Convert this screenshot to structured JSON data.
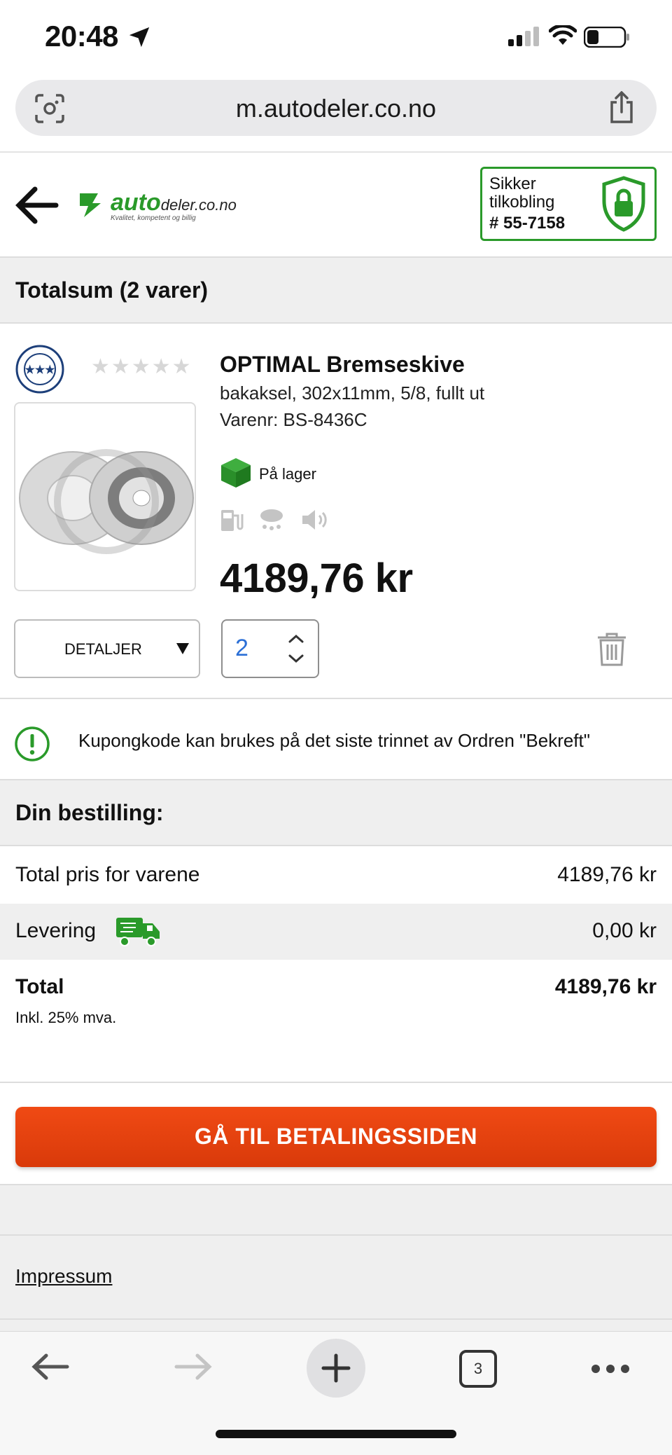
{
  "status_bar": {
    "time": "20:48"
  },
  "browser": {
    "url": "m.autodeler.co.no",
    "tab_count": "3"
  },
  "header": {
    "logo_word": "auto",
    "logo_word_small": "deler.co.no",
    "logo_tagline": "Kvalitet, kompetent og billig",
    "secure_line1": "Sikker",
    "secure_line2": "tilkobling",
    "secure_id": "# 55-7158"
  },
  "cart": {
    "title": "Totalsum (2 varer)",
    "item": {
      "name": "OPTIMAL Bremseskive",
      "description": "bakaksel, 302x11mm, 5/8, fullt ut",
      "sku": "Varenr: BS-8436C",
      "stock": "På lager",
      "price": "4189,76 kr",
      "rating": 0,
      "details_label": "DETALJER",
      "quantity": "2"
    }
  },
  "coupon": {
    "text": "Kupongkode kan brukes på det siste trinnet av Ordren \"Bekreft\""
  },
  "order": {
    "title": "Din bestilling:",
    "items_label": "Total pris for varene",
    "items_value": "4189,76 kr",
    "delivery_label": "Levering",
    "delivery_value": "0,00 kr",
    "total_label": "Total",
    "total_value": "4189,76 kr",
    "vat_note": "Inkl. 25% mva."
  },
  "cta": {
    "label": "GÅ TIL BETALINGSSIDEN"
  },
  "footer": {
    "impressum": "Impressum"
  },
  "colors": {
    "accent_green": "#2a9a2a",
    "cta_orange": "#e8420f",
    "qty_blue": "#2b6fd6"
  },
  "icons": [
    "location-arrow-icon",
    "signal-icon",
    "wifi-icon",
    "battery-icon",
    "camera-search-icon",
    "share-icon",
    "back-arrow-icon",
    "shield-lock-icon",
    "star-icon",
    "box-icon",
    "fuel-icon",
    "rain-icon",
    "noise-icon",
    "chevron-up-icon",
    "chevron-down-icon",
    "trash-icon",
    "alert-circle-icon",
    "delivery-truck-icon",
    "browser-back-icon",
    "browser-forward-icon",
    "plus-icon",
    "tabs-icon",
    "more-icon"
  ]
}
